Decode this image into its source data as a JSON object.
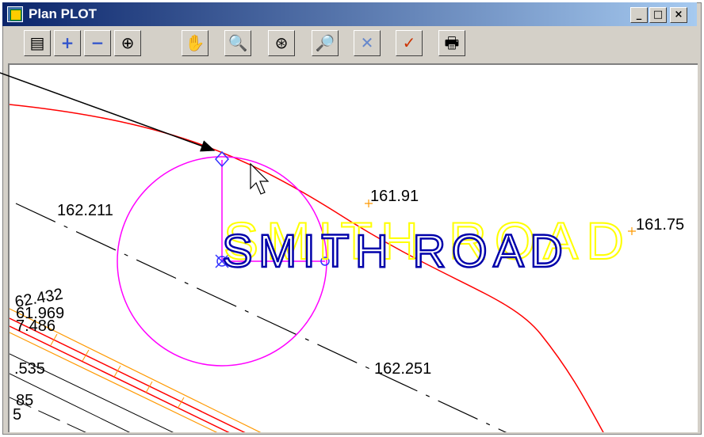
{
  "window": {
    "title": "Plan PLOT",
    "controls": {
      "minimize": "_",
      "maximize": "□",
      "close": "×"
    }
  },
  "toolbar": {
    "tools": [
      {
        "name": "plot-parameters-icon",
        "glyph": "▤"
      },
      {
        "name": "zoom-in-icon",
        "glyph": "+"
      },
      {
        "name": "zoom-out-icon",
        "glyph": "−"
      },
      {
        "name": "zoom-center-icon",
        "glyph": "⊕"
      },
      {
        "name": "pan-hand-icon",
        "glyph": "✋"
      },
      {
        "name": "zoom-plus-minus-icon",
        "glyph": "🔍"
      },
      {
        "name": "zoom-extents-icon",
        "glyph": "⊛"
      },
      {
        "name": "zoom-previous-icon",
        "glyph": "🔎"
      },
      {
        "name": "clear-icon",
        "glyph": "✕"
      },
      {
        "name": "pick-icon",
        "glyph": "✓"
      },
      {
        "name": "print-icon",
        "glyph": "🖶"
      }
    ]
  },
  "plan": {
    "labels": {
      "lbl1": "162.211",
      "lbl2": "161.91",
      "lbl3": "161.75",
      "lbl4": "62.432",
      "lbl5": "61.969",
      "lbl6": "7.486",
      "lbl7": ".535",
      "lbl8": "162.251",
      "lbl9": "85",
      "lbl10": "5"
    },
    "road_text": "SMITH ROAD",
    "colors": {
      "road_edge": "#ff0000",
      "circle": "#ff00ff",
      "text_shadow": "#ffff00",
      "text_outline": "#0000aa",
      "orange": "#ff9900",
      "handle": "#3333ff"
    }
  }
}
